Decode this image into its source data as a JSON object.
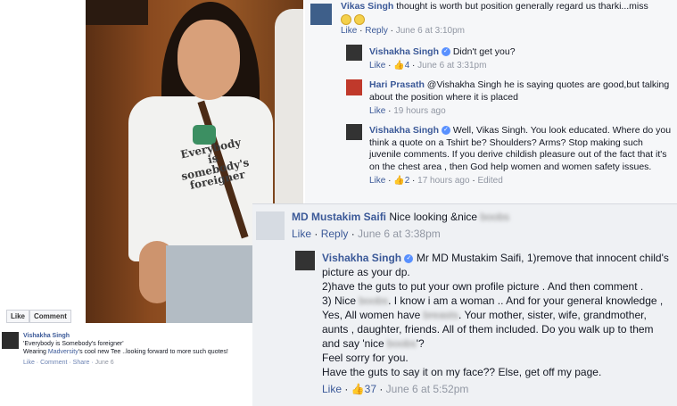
{
  "left_post": {
    "like_label": "Like",
    "comment_label": "Comment",
    "author": "Vishakha Singh",
    "quote": "'Everybody is Somebody's foreigner'",
    "text_prefix": "Wearing",
    "brand": "Madversity",
    "text_suffix": "'s cool new Tee ..looking forward to more such quotes!",
    "actions": [
      "Like",
      "Comment",
      "Share"
    ],
    "date": "June 6",
    "shirt_text": "Everybody is somebody's foreigner"
  },
  "top_comments": [
    {
      "author": "Vikas Singh",
      "text": "thought is worth but position generally regard us tharki...miss",
      "like": "Like",
      "reply": "Reply",
      "time": "June 6 at 3:10pm"
    },
    {
      "author": "Vishakha Singh",
      "text": "Didn't get you?",
      "like": "Like",
      "likes_count": "4",
      "time": "June 6 at 3:31pm"
    },
    {
      "author": "Hari Prasath",
      "text": "@Vishakha Singh he is saying quotes are good,but talking about the position where it is placed",
      "like": "Like",
      "time": "19 hours ago"
    },
    {
      "author": "Vishakha Singh",
      "text": "Well, Vikas Singh. You look educated. Where do you think a quote on a Tshirt be? Shoulders? Arms? Stop making such juvenile comments. If you derive childish pleasure out of the fact that it's on the chest area , then God help women and women safety issues.",
      "like": "Like",
      "likes_count": "2",
      "time": "17 hours ago",
      "edited": "Edited"
    }
  ],
  "bottom_comments": [
    {
      "author": "MD Mustakim Saifi",
      "text_prefix": "Nice looking &nice",
      "blurred_word": "boobs",
      "like": "Like",
      "reply": "Reply",
      "time": "June 6 at 3:38pm"
    },
    {
      "author": "Vishakha Singh",
      "line1": "Mr MD Mustakim Saifi, 1)remove that innocent child's picture as your dp.",
      "line2": "2)have the guts to put your own profile picture . And then comment .",
      "line3_a": "3) Nice",
      "line3_blur": "boobs",
      "line3_b": ". I know i am a woman .. And for your general knowledge , Yes, All women have",
      "line3_blur2": "breasts",
      "line3_c": ". Your mother, sister, wife, grandmother, aunts , daughter, friends. All of them included. Do you walk up to them and say 'nice",
      "line3_blur3": "boobs",
      "line3_d": "'?",
      "line4": "Feel sorry for you.",
      "line5": "Have the guts to say it on my face?? Else, get off my page.",
      "like": "Like",
      "likes_count": "37",
      "time": "June 6 at 5:52pm"
    }
  ]
}
